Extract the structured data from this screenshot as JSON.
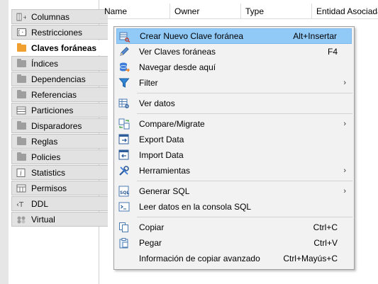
{
  "sidebar": {
    "tabs": [
      {
        "label": "Columnas",
        "icon": "columns-icon"
      },
      {
        "label": "Restricciones",
        "icon": "constraints-icon"
      },
      {
        "label": "Claves foráneas",
        "icon": "folder-icon"
      },
      {
        "label": "Índices",
        "icon": "folder-icon"
      },
      {
        "label": "Dependencias",
        "icon": "folder-icon"
      },
      {
        "label": "Referencias",
        "icon": "folder-icon"
      },
      {
        "label": "Particiones",
        "icon": "partitions-icon"
      },
      {
        "label": "Disparadores",
        "icon": "folder-icon"
      },
      {
        "label": "Reglas",
        "icon": "folder-icon"
      },
      {
        "label": "Policies",
        "icon": "folder-icon"
      },
      {
        "label": "Statistics",
        "icon": "info-icon"
      },
      {
        "label": "Permisos",
        "icon": "permissions-icon"
      },
      {
        "label": "DDL",
        "icon": "ddl-icon"
      },
      {
        "label": "Virtual",
        "icon": "virtual-icon"
      }
    ],
    "active_index": 2,
    "active_color": "#f0a030"
  },
  "table": {
    "columns": [
      "Name",
      "Owner",
      "Type",
      "Entidad Asociada"
    ]
  },
  "context_menu": {
    "items": [
      {
        "label": "Crear Nuevo Clave foránea",
        "shortcut": "Alt+Insertar",
        "icon": "create-fk-icon",
        "highlighted": true
      },
      {
        "label": "Ver Claves foráneas",
        "shortcut": "F4",
        "icon": "edit-pencil-icon"
      },
      {
        "label": "Navegar desde aquí",
        "shortcut": "",
        "icon": "database-icon"
      },
      {
        "label": "Filter",
        "shortcut": "",
        "icon": "filter-icon",
        "submenu": true
      },
      {
        "label": "Ver datos",
        "shortcut": "",
        "icon": "view-data-icon"
      },
      {
        "label": "Compare/Migrate",
        "shortcut": "",
        "icon": "compare-icon",
        "submenu": true
      },
      {
        "label": "Export Data",
        "shortcut": "",
        "icon": "export-icon"
      },
      {
        "label": "Import Data",
        "shortcut": "",
        "icon": "import-icon"
      },
      {
        "label": "Herramientas",
        "shortcut": "",
        "icon": "tools-icon",
        "submenu": true
      },
      {
        "label": "Generar SQL",
        "shortcut": "",
        "icon": "sql-icon",
        "submenu": true
      },
      {
        "label": "Leer datos en la consola SQL",
        "shortcut": "",
        "icon": "console-icon"
      },
      {
        "label": "Copiar",
        "shortcut": "Ctrl+C",
        "icon": "copy-icon"
      },
      {
        "label": "Pegar",
        "shortcut": "Ctrl+V",
        "icon": "paste-icon"
      },
      {
        "label": "Información de copiar avanzado",
        "shortcut": "Ctrl+Mayús+C",
        "icon": ""
      }
    ],
    "submenu_arrow": "›",
    "highlight_color": "#91c9f7"
  }
}
